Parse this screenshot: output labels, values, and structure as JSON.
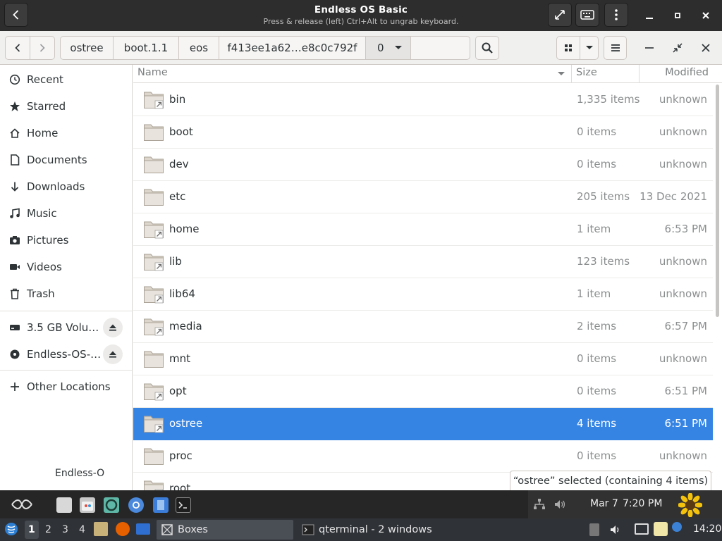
{
  "vm": {
    "title": "Endless OS Basic",
    "subtitle": "Press & release (left) Ctrl+Alt to ungrab keyboard."
  },
  "path_bar": {
    "segments": [
      "ostree",
      "boot.1.1",
      "eos",
      "f413ee1a62…e8c0c792f",
      "0"
    ]
  },
  "sidebar": {
    "items": [
      {
        "label": "Recent",
        "icon": "clock-icon"
      },
      {
        "label": "Starred",
        "icon": "star-icon"
      },
      {
        "label": "Home",
        "icon": "home-icon"
      },
      {
        "label": "Documents",
        "icon": "document-icon"
      },
      {
        "label": "Downloads",
        "icon": "download-icon"
      },
      {
        "label": "Music",
        "icon": "music-icon"
      },
      {
        "label": "Pictures",
        "icon": "camera-icon"
      },
      {
        "label": "Videos",
        "icon": "video-icon"
      },
      {
        "label": "Trash",
        "icon": "trash-icon"
      }
    ],
    "volumes": [
      {
        "label": "3.5 GB Volu…",
        "icon": "drive-icon"
      },
      {
        "label": "Endless-OS-…",
        "icon": "disc-icon"
      }
    ],
    "other_locations": "Other Locations",
    "overlap_text": "Endless-O"
  },
  "columns": {
    "name": "Name",
    "size": "Size",
    "modified": "Modified"
  },
  "files": [
    {
      "name": "bin",
      "size": "1,335 items",
      "modified": "unknown",
      "link": true
    },
    {
      "name": "boot",
      "size": "0 items",
      "modified": "unknown",
      "link": false
    },
    {
      "name": "dev",
      "size": "0 items",
      "modified": "unknown",
      "link": false
    },
    {
      "name": "etc",
      "size": "205 items",
      "modified": "13 Dec 2021",
      "link": false
    },
    {
      "name": "home",
      "size": "1 item",
      "modified": "6:53 PM",
      "link": true
    },
    {
      "name": "lib",
      "size": "123 items",
      "modified": "unknown",
      "link": true
    },
    {
      "name": "lib64",
      "size": "1 item",
      "modified": "unknown",
      "link": true
    },
    {
      "name": "media",
      "size": "2 items",
      "modified": "6:57 PM",
      "link": true
    },
    {
      "name": "mnt",
      "size": "0 items",
      "modified": "unknown",
      "link": false
    },
    {
      "name": "opt",
      "size": "0 items",
      "modified": "6:51 PM",
      "link": true
    },
    {
      "name": "ostree",
      "size": "4 items",
      "modified": "6:51 PM",
      "link": true,
      "selected": true
    },
    {
      "name": "proc",
      "size": "0 items",
      "modified": "unknown",
      "link": false
    },
    {
      "name": "root",
      "size": "",
      "modified": "",
      "link": true
    }
  ],
  "status": "“ostree” selected  (containing 4 items)",
  "eos_taskbar": {
    "date": "Mar 7",
    "time": "7:20 PM"
  },
  "host_panel": {
    "workspaces": [
      "1",
      "2",
      "3",
      "4"
    ],
    "tasks": [
      {
        "label": "Boxes",
        "icon": "boxes-icon"
      },
      {
        "label": "qterminal - 2 windows",
        "icon": "terminal-icon"
      }
    ],
    "clock": "14:20"
  },
  "colors": {
    "selection": "#3584e4",
    "folder": "#e8e3dc"
  }
}
